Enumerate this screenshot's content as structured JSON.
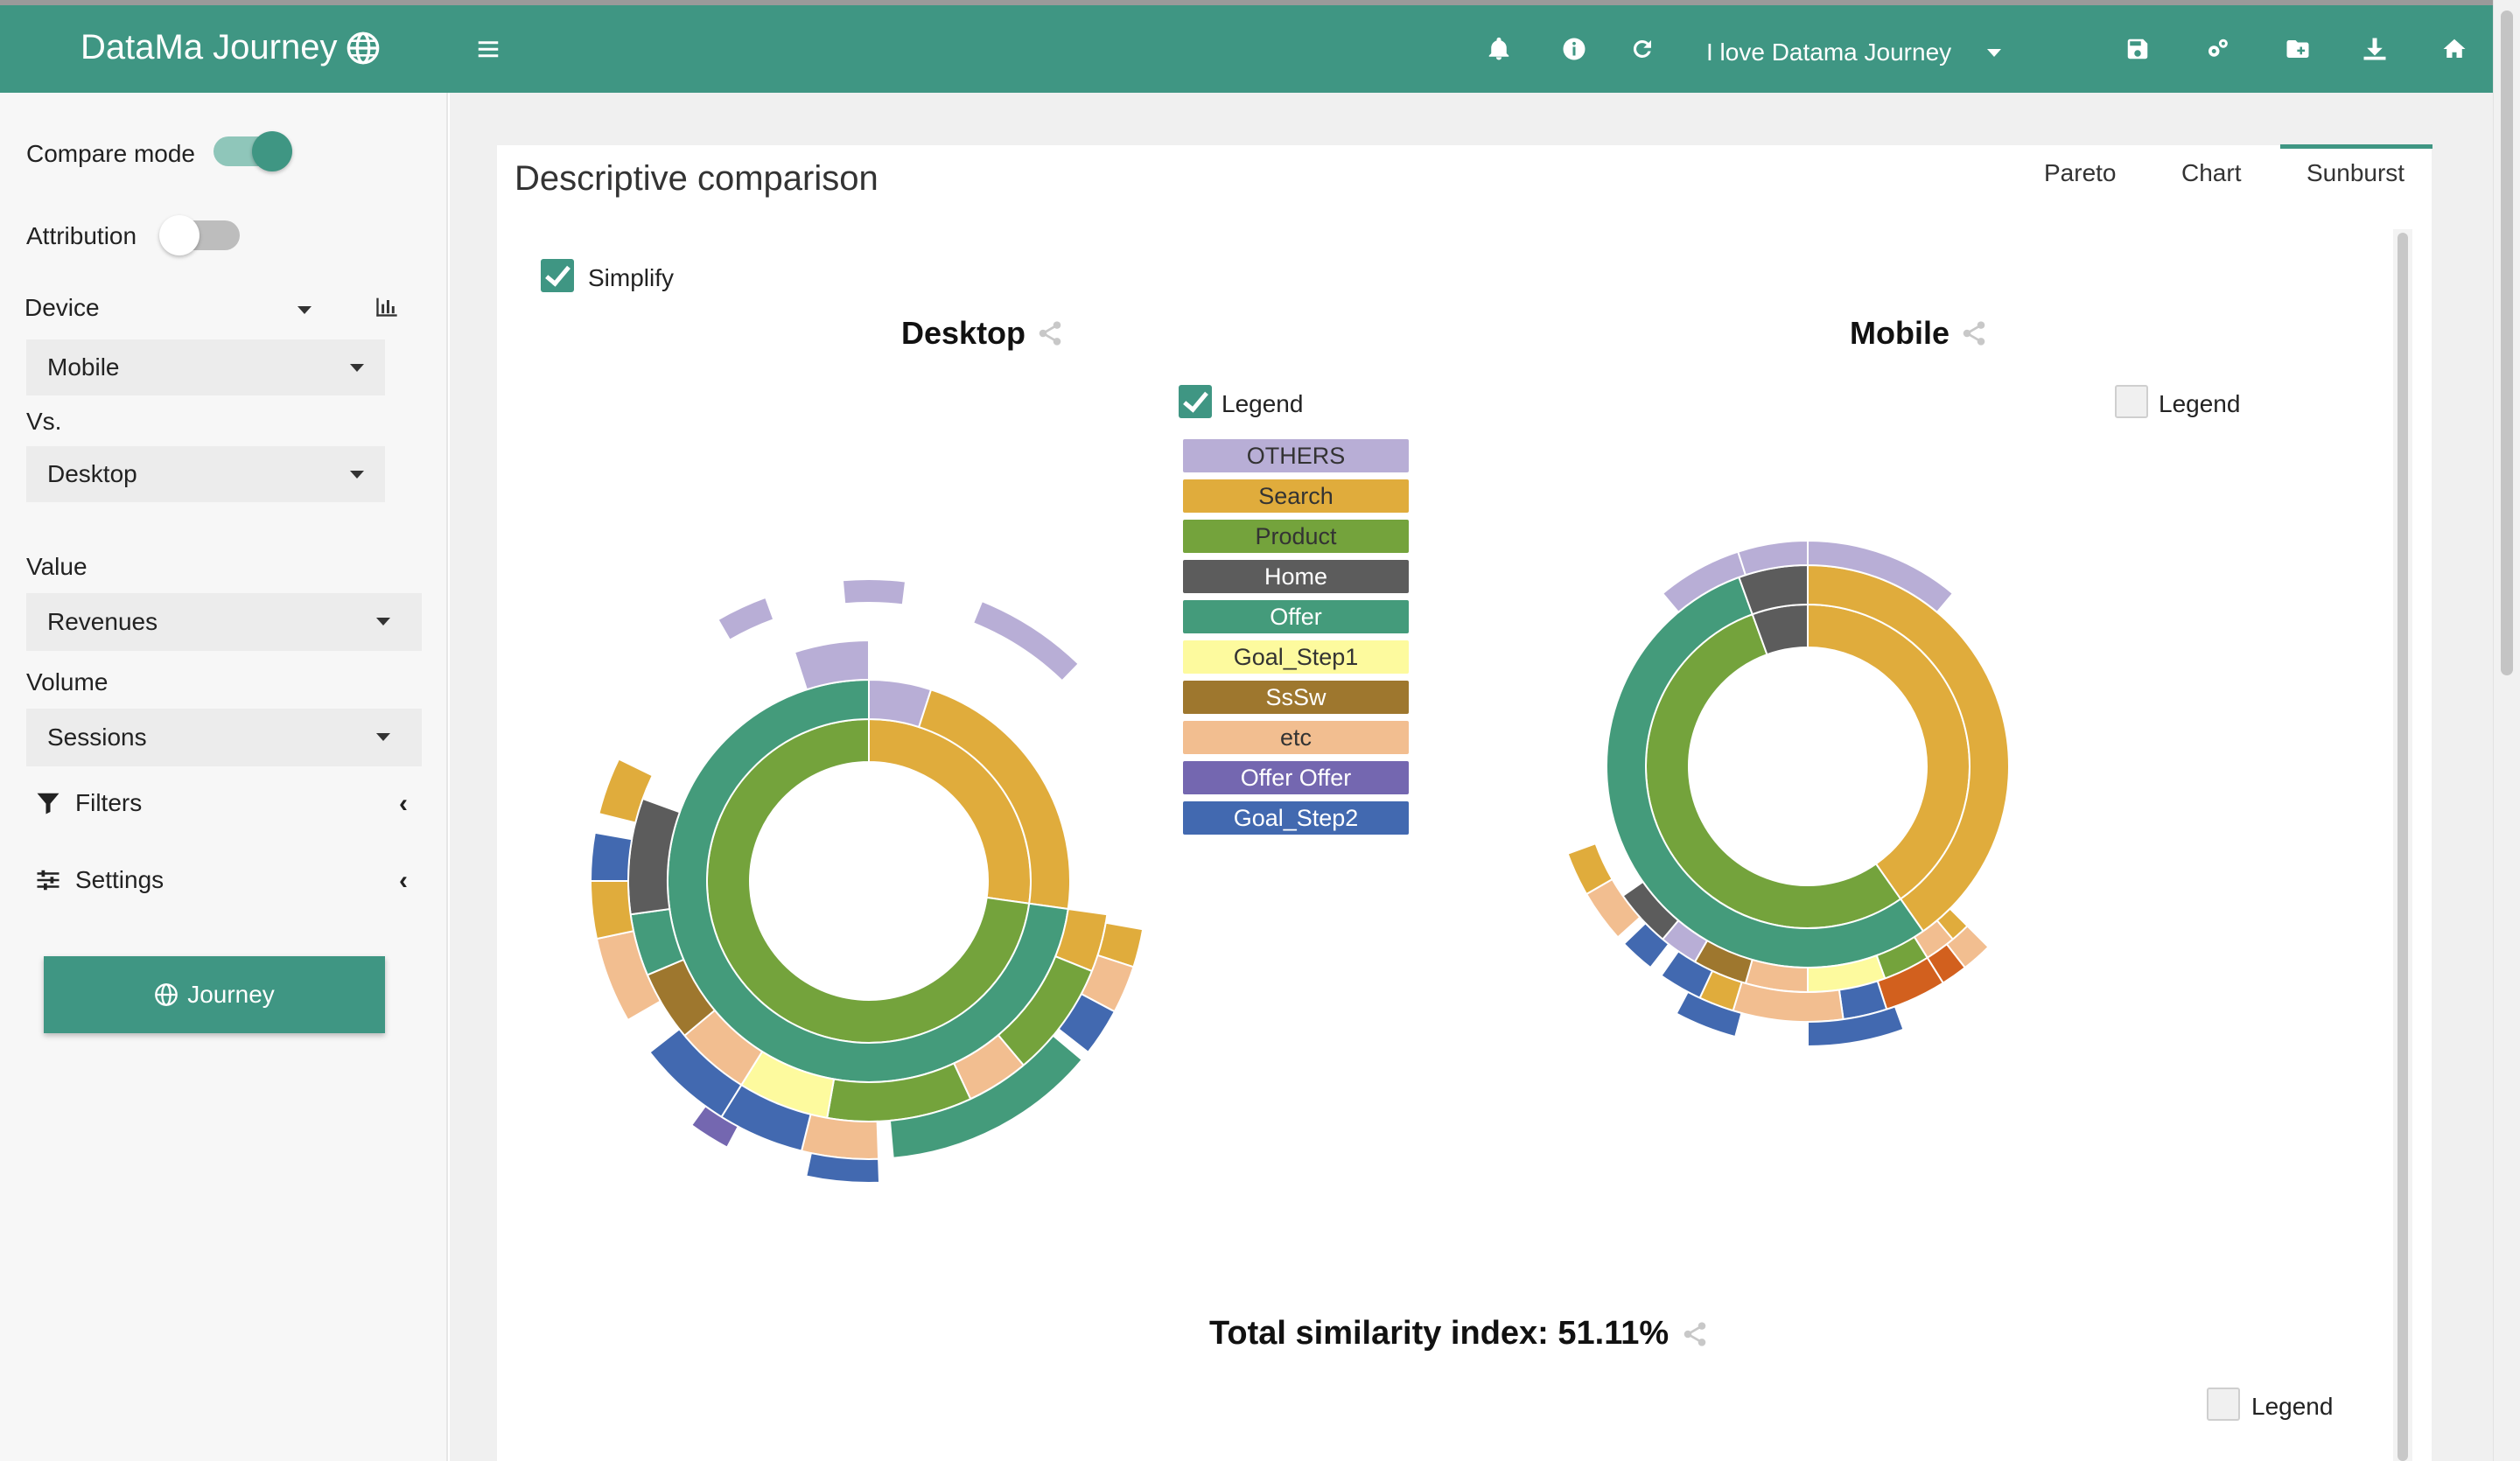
{
  "app": {
    "title": "DataMa Journey",
    "project_name": "I love Datama Journey"
  },
  "topbar": {
    "icons": [
      "menu-icon",
      "bell-icon",
      "info-icon",
      "refresh-icon",
      "save-icon",
      "settings-icon",
      "folder-plus-icon",
      "download-icon",
      "home-icon"
    ]
  },
  "sidebar": {
    "compare_mode": {
      "label": "Compare mode",
      "on": true
    },
    "attribution": {
      "label": "Attribution",
      "on": false
    },
    "device": {
      "label": "Device",
      "value": "Mobile"
    },
    "vs": {
      "label": "Vs.",
      "value": "Desktop"
    },
    "value": {
      "label": "Value",
      "selected": "Revenues"
    },
    "volume": {
      "label": "Volume",
      "selected": "Sessions"
    },
    "filters_label": "Filters",
    "settings_label": "Settings",
    "journey_button": "Journey"
  },
  "main": {
    "title": "Descriptive comparison",
    "tabs": [
      "Pareto",
      "Chart",
      "Sunburst"
    ],
    "active_tab": "Sunburst",
    "simplify_label": "Simplify",
    "left_chart": {
      "title": "Desktop",
      "legend_label": "Legend",
      "legend_checked": true
    },
    "right_chart": {
      "title": "Mobile",
      "legend_label": "Legend",
      "legend_checked": false
    },
    "bottom_legend_label": "Legend",
    "similarity_text": "Total similarity index: 51.11%"
  },
  "legend": [
    {
      "label": "OTHERS",
      "color": "#b8aed6",
      "text_color": "#333"
    },
    {
      "label": "Search",
      "color": "#e0ac3c",
      "text_color": "#333"
    },
    {
      "label": "Product",
      "color": "#74a33c",
      "text_color": "#333"
    },
    {
      "label": "Home",
      "color": "#5c5c5c",
      "text_color": "#ffffff"
    },
    {
      "label": "Offer",
      "color": "#449b7b",
      "text_color": "#ffffff"
    },
    {
      "label": "Goal_Step1",
      "color": "#fdfa9e",
      "text_color": "#333"
    },
    {
      "label": "SsSw",
      "color": "#9e772e",
      "text_color": "#ffffff"
    },
    {
      "label": "etc",
      "color": "#f2be90",
      "text_color": "#333"
    },
    {
      "label": "Offer Offer",
      "color": "#7467b0",
      "text_color": "#ffffff"
    },
    {
      "label": "Goal_Step2",
      "color": "#4269b0",
      "text_color": "#ffffff"
    }
  ],
  "colors": {
    "accent": "#3f9683",
    "Orange": "#d2601e"
  }
}
